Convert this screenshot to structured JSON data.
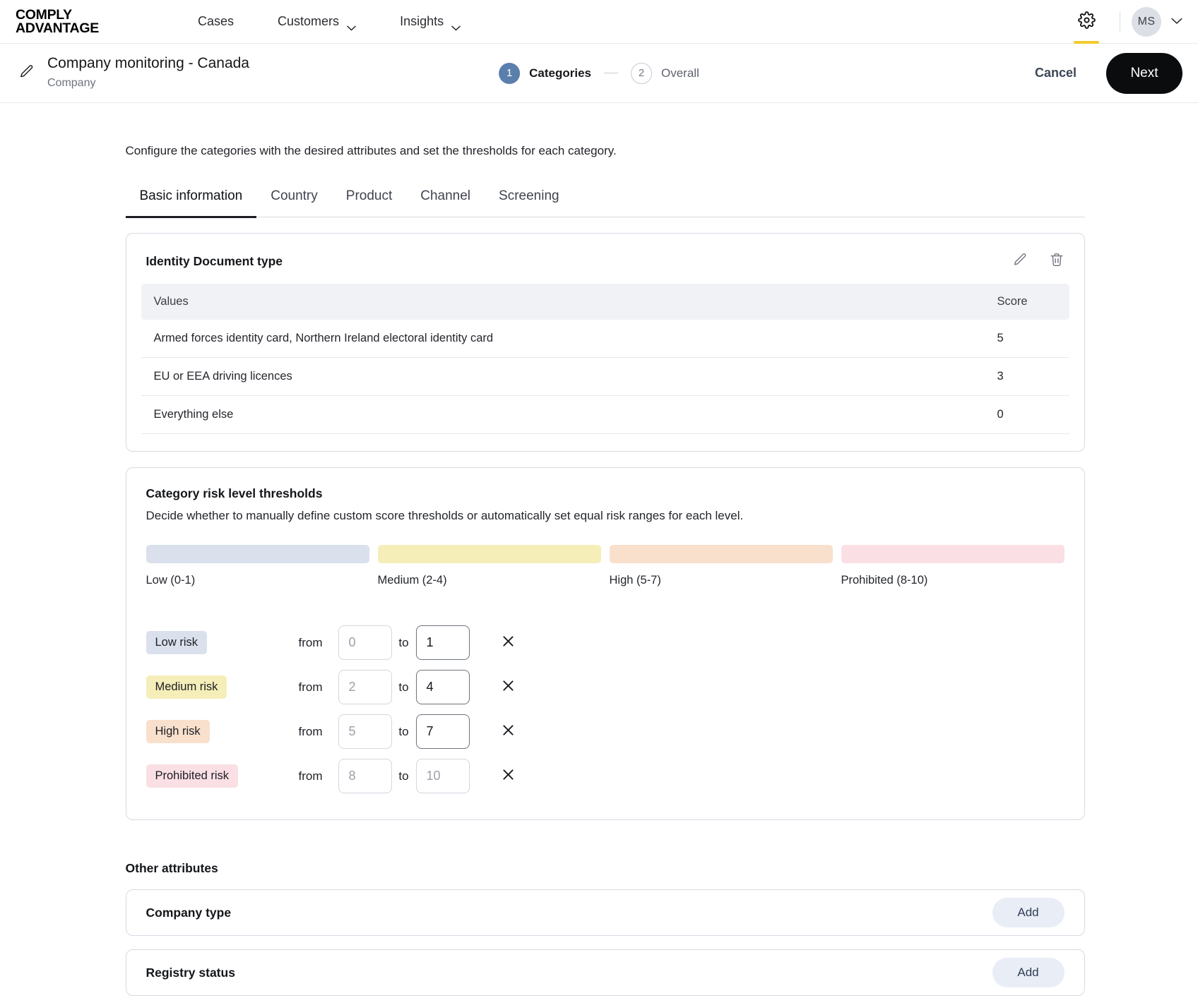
{
  "topnav": {
    "logo_line1": "COMPLY",
    "logo_line2": "ADVANTAGE",
    "items": [
      {
        "label": "Cases",
        "has_caret": false
      },
      {
        "label": "Customers",
        "has_caret": true
      },
      {
        "label": "Insights",
        "has_caret": true
      }
    ],
    "settings_icon": "gear-icon",
    "avatar_initials": "MS",
    "accent_underline_color": "#f2cb2e"
  },
  "subheader": {
    "edit_icon": "pencil-icon",
    "title": "Company monitoring - Canada",
    "subtitle": "Company",
    "steps": [
      {
        "number": "1",
        "label": "Categories",
        "state": "active"
      },
      {
        "number": "2",
        "label": "Overall",
        "state": "idle"
      }
    ],
    "cancel_label": "Cancel",
    "next_label": "Next",
    "active_step_color": "#5a7fad"
  },
  "main": {
    "description": "Configure the categories with the desired attributes and set the thresholds for each category.",
    "tabs": [
      {
        "label": "Basic information",
        "active": true
      },
      {
        "label": "Country",
        "active": false
      },
      {
        "label": "Product",
        "active": false
      },
      {
        "label": "Channel",
        "active": false
      },
      {
        "label": "Screening",
        "active": false
      }
    ]
  },
  "identity_card": {
    "title": "Identity Document type",
    "edit_icon": "pencil-icon",
    "delete_icon": "trash-icon",
    "columns": [
      "Values",
      "Score"
    ],
    "rows": [
      {
        "value": "Armed forces identity card, Northern Ireland electoral identity card",
        "score": "5"
      },
      {
        "value": "EU or EEA driving licences",
        "score": "3"
      },
      {
        "value": "Everything else",
        "score": "0"
      }
    ]
  },
  "thresholds_card": {
    "title": "Category risk level thresholds",
    "subtitle": "Decide whether to manually define custom score thresholds or automatically set equal risk ranges for each level.",
    "legend": [
      {
        "label": "Low (0-1)",
        "color": "#dbe0ed"
      },
      {
        "label": "Medium (2-4)",
        "color": "#f5eeb9"
      },
      {
        "label": "High (5-7)",
        "color": "#f9e0cd"
      },
      {
        "label": "Prohibited (8-10)",
        "color": "#fadfe4"
      }
    ],
    "from_label": "from",
    "to_label": "to",
    "remove_icon": "close-icon",
    "rows": [
      {
        "chip": "Low risk",
        "chip_color": "#dbe0ed",
        "from_value": "0",
        "from_filled": false,
        "to_value": "1",
        "to_filled": true
      },
      {
        "chip": "Medium risk",
        "chip_color": "#f5eeb9",
        "from_value": "2",
        "from_filled": false,
        "to_value": "4",
        "to_filled": true
      },
      {
        "chip": "High risk",
        "chip_color": "#f9e0cd",
        "from_value": "5",
        "from_filled": false,
        "to_value": "7",
        "to_filled": true
      },
      {
        "chip": "Prohibited risk",
        "chip_color": "#fadfe4",
        "from_value": "8",
        "from_filled": false,
        "to_value": "10",
        "to_filled": false
      }
    ]
  },
  "other_attributes": {
    "heading": "Other attributes",
    "items": [
      {
        "name": "Company type",
        "action_label": "Add"
      },
      {
        "name": "Registry status",
        "action_label": "Add"
      }
    ]
  }
}
